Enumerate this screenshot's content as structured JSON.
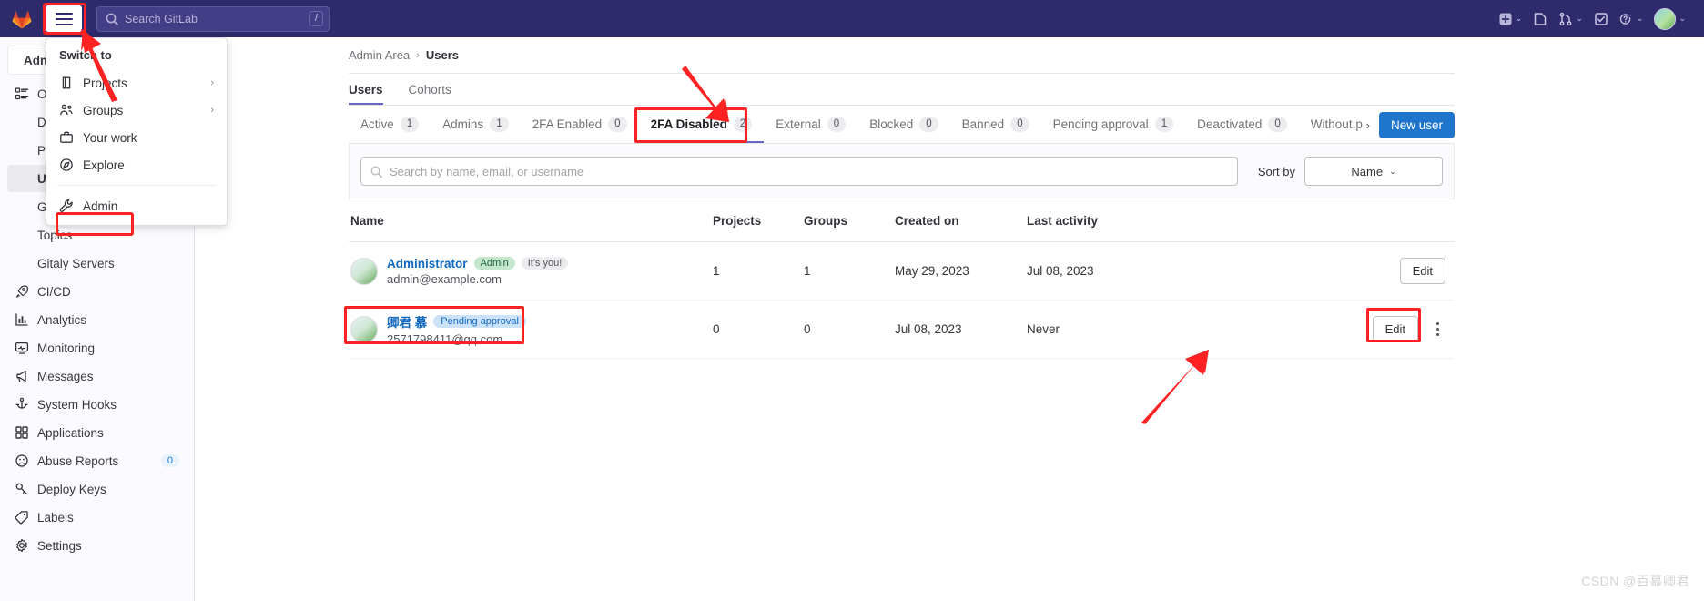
{
  "topbar": {
    "logo_icon": "gitlab-logo-icon",
    "hamburger_icon": "hamburger-menu-icon",
    "search": {
      "placeholder": "Search GitLab",
      "shortcut": "/",
      "icon": "search-icon"
    },
    "right_items": [
      {
        "icon": "create-new-icon",
        "label": "Create new",
        "caret": "⌄"
      },
      {
        "icon": "issues-icon",
        "label": "Issues"
      },
      {
        "icon": "merge-requests-icon",
        "label": "Merge requests",
        "caret": "⌄"
      },
      {
        "icon": "todos-icon",
        "label": "To-Do list"
      },
      {
        "icon": "help-icon",
        "label": "Help",
        "caret": "⌄"
      },
      {
        "icon": "user-avatar",
        "label": "User menu",
        "caret": "⌄"
      }
    ],
    "accent_bg": "#2f2a6b"
  },
  "sidebar": {
    "context": {
      "label": "Admin Area",
      "icon": "wrench-icon"
    },
    "items": [
      {
        "label": "Overview",
        "icon": "overview-icon",
        "sub": false,
        "active": false,
        "badge": ""
      },
      {
        "label": "Dashboard",
        "icon": "",
        "sub": true,
        "active": false,
        "badge": ""
      },
      {
        "label": "Projects",
        "icon": "",
        "sub": true,
        "active": false,
        "badge": ""
      },
      {
        "label": "Users",
        "icon": "",
        "sub": true,
        "active": true,
        "badge": ""
      },
      {
        "label": "Groups",
        "icon": "",
        "sub": true,
        "active": false,
        "badge": ""
      },
      {
        "label": "Topics",
        "icon": "",
        "sub": true,
        "active": false,
        "badge": ""
      },
      {
        "label": "Gitaly Servers",
        "icon": "",
        "sub": true,
        "active": false,
        "badge": ""
      },
      {
        "label": "CI/CD",
        "icon": "rocket-icon",
        "sub": false,
        "active": false,
        "badge": ""
      },
      {
        "label": "Analytics",
        "icon": "chart-icon",
        "sub": false,
        "active": false,
        "badge": ""
      },
      {
        "label": "Monitoring",
        "icon": "monitor-icon",
        "sub": false,
        "active": false,
        "badge": ""
      },
      {
        "label": "Messages",
        "icon": "megaphone-icon",
        "sub": false,
        "active": false,
        "badge": ""
      },
      {
        "label": "System Hooks",
        "icon": "hook-icon",
        "sub": false,
        "active": false,
        "badge": ""
      },
      {
        "label": "Applications",
        "icon": "applications-icon",
        "sub": false,
        "active": false,
        "badge": ""
      },
      {
        "label": "Abuse Reports",
        "icon": "abuse-icon",
        "sub": false,
        "active": false,
        "badge": "0"
      },
      {
        "label": "Deploy Keys",
        "icon": "key-icon",
        "sub": false,
        "active": false,
        "badge": ""
      },
      {
        "label": "Labels",
        "icon": "label-icon",
        "sub": false,
        "active": false,
        "badge": ""
      },
      {
        "label": "Settings",
        "icon": "gear-icon",
        "sub": false,
        "active": false,
        "badge": ""
      }
    ]
  },
  "dropdown": {
    "title": "Switch to",
    "items": [
      {
        "label": "Projects",
        "icon": "project-icon",
        "chevron": "›"
      },
      {
        "label": "Groups",
        "icon": "group-icon",
        "chevron": "›"
      },
      {
        "label": "Your work",
        "icon": "briefcase-icon",
        "chevron": ""
      },
      {
        "label": "Explore",
        "icon": "compass-icon",
        "chevron": ""
      }
    ],
    "footer": {
      "label": "Admin",
      "icon": "wrench-icon"
    }
  },
  "breadcrumb": {
    "root": "Admin Area",
    "separator": "›",
    "current": "Users"
  },
  "page_tabs": [
    {
      "label": "Users",
      "selected": true
    },
    {
      "label": "Cohorts",
      "selected": false
    }
  ],
  "filter_tabs": [
    {
      "label": "Active",
      "count": "1",
      "selected": false
    },
    {
      "label": "Admins",
      "count": "1",
      "selected": false
    },
    {
      "label": "2FA Enabled",
      "count": "0",
      "selected": false
    },
    {
      "label": "2FA Disabled",
      "count": "2",
      "selected": true
    },
    {
      "label": "External",
      "count": "0",
      "selected": false
    },
    {
      "label": "Blocked",
      "count": "0",
      "selected": false
    },
    {
      "label": "Banned",
      "count": "0",
      "selected": false
    },
    {
      "label": "Pending approval",
      "count": "1",
      "selected": false
    },
    {
      "label": "Deactivated",
      "count": "0",
      "selected": false
    },
    {
      "label": "Without p",
      "count": "",
      "selected": false
    }
  ],
  "filter_scroll_chevron": "›",
  "new_user_button": "New user",
  "search_panel": {
    "placeholder": "Search by name, email, or username",
    "search_icon": "search-icon",
    "sort_label": "Sort by",
    "sort_value": "Name",
    "sort_caret": "⌄"
  },
  "table": {
    "columns": [
      "Name",
      "Projects",
      "Groups",
      "Created on",
      "Last activity",
      ""
    ],
    "rows": [
      {
        "name": "Administrator",
        "badges": [
          {
            "text": "Admin",
            "kind": "admin"
          },
          {
            "text": "It's you!",
            "kind": "you"
          }
        ],
        "email": "admin@example.com",
        "projects": "1",
        "groups": "1",
        "created_on": "May 29, 2023",
        "last_activity": "Jul 08, 2023",
        "edit_label": "Edit",
        "has_kebab": false
      },
      {
        "name": "卿君 慕",
        "badges": [
          {
            "text": "Pending approval",
            "kind": "pending"
          }
        ],
        "email": "2571798411@qq.com",
        "projects": "0",
        "groups": "0",
        "created_on": "Jul 08, 2023",
        "last_activity": "Never",
        "edit_label": "Edit",
        "has_kebab": true
      }
    ]
  },
  "annotations": {
    "highlight_color": "#ff2222",
    "boxes": [
      "hamburger-menu",
      "admin-menu-item",
      "2fa-disabled-tab",
      "user-row-2-name",
      "user-row-2-edit-button"
    ],
    "arrows": [
      "arrow-to-hamburger",
      "arrow-to-2fa-disabled",
      "arrow-to-edit-button"
    ]
  },
  "watermark": "CSDN @百慕卿君"
}
